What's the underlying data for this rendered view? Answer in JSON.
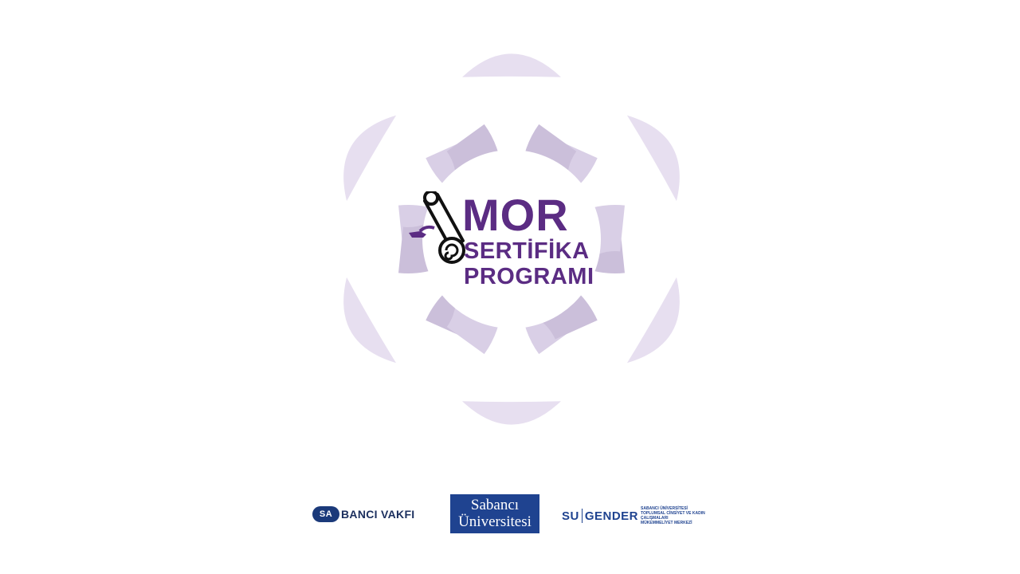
{
  "title": {
    "line1": "MOR",
    "line2": "SERTİFİKA",
    "line3": "PROGRAMI"
  },
  "footer": {
    "vakfi_badge": "SA",
    "vakfi_text": "BANCI VAKFI",
    "university_line1": "Sabancı",
    "university_line2": "Üniversitesi",
    "sugender_su": "SU",
    "sugender_gender": "GENDER",
    "sugender_desc_line1": "SABANCI ÜNİVERSİTESİ",
    "sugender_desc_line2": "TOPLUMSAL CİNSİYET VE KADIN ÇALIŞMALARI",
    "sugender_desc_line3": "MÜKEMMELİYET MERKEZİ"
  },
  "colors": {
    "brand_purple": "#5b2c83",
    "petal_dark": "#cbbfda",
    "petal_mid": "#d9cfe6",
    "petal_light": "#e7dff0",
    "university_blue": "#1f4390"
  }
}
